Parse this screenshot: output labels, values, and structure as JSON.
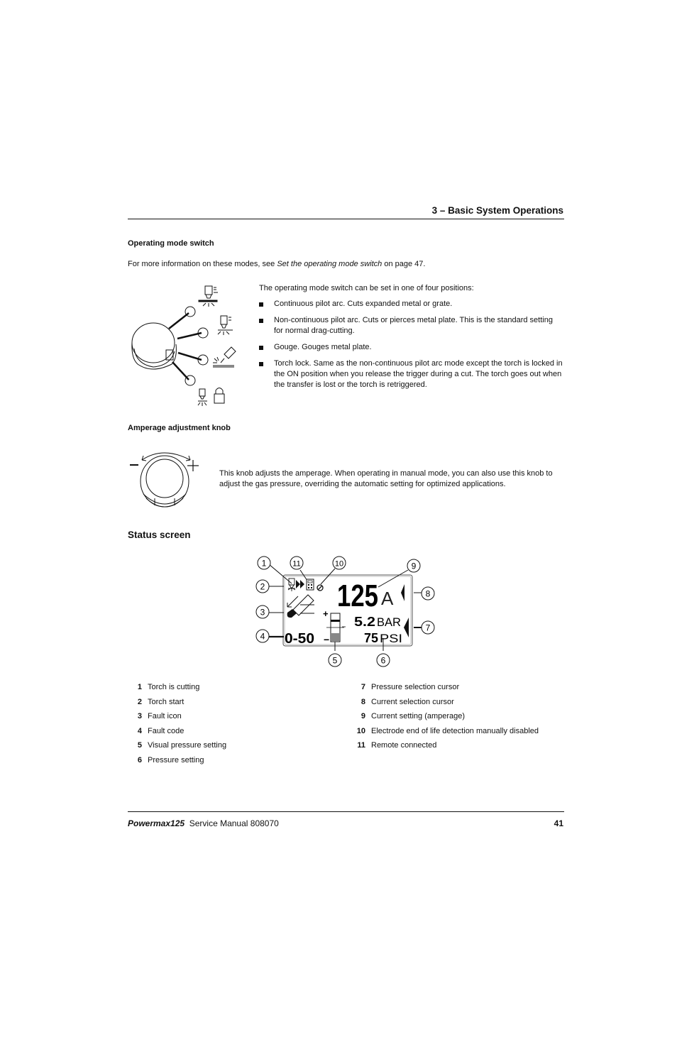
{
  "header": {
    "chapter_title": "3 – Basic System Operations"
  },
  "operating_mode": {
    "heading": "Operating mode switch",
    "intro_prefix": "For more information on these modes, see ",
    "intro_link": "Set the operating mode switch",
    "intro_suffix": " on page 47.",
    "lead": "The operating mode switch can be set in one of four positions:",
    "positions": [
      "Continuous pilot arc. Cuts expanded metal or grate.",
      "Non-continuous pilot arc. Cuts or pierces metal plate. This is the standard setting for normal drag-cutting.",
      "Gouge. Gouges metal plate.",
      "Torch lock. Same as the non-continuous pilot arc mode except the torch is locked in the ON position when you release the trigger during a cut. The torch goes out when the transfer is lost or the torch is retriggered."
    ]
  },
  "amperage_knob": {
    "heading": "Amperage adjustment knob",
    "minus_label": "−",
    "plus_label": "+",
    "description": "This knob adjusts the amperage. When operating in manual mode, you can also use this knob to adjust the gas pressure, overriding the automatic setting for optimized applications."
  },
  "status_screen": {
    "heading": "Status screen",
    "display": {
      "current_value": "125",
      "current_unit": "A",
      "pressure_bar": "5.2",
      "pressure_bar_unit": "BAR",
      "pressure_psi": "75",
      "pressure_psi_unit": "PSI",
      "fault_code": "0-50",
      "plus_sign": "+",
      "minus_sign": "−"
    },
    "callouts": [
      "1",
      "2",
      "3",
      "4",
      "5",
      "6",
      "7",
      "8",
      "9",
      "10",
      "11"
    ],
    "legend_left": [
      {
        "num": "1",
        "label": "Torch is cutting"
      },
      {
        "num": "2",
        "label": "Torch start"
      },
      {
        "num": "3",
        "label": "Fault icon"
      },
      {
        "num": "4",
        "label": "Fault code"
      },
      {
        "num": "5",
        "label": "Visual pressure setting"
      },
      {
        "num": "6",
        "label": "Pressure setting"
      }
    ],
    "legend_right": [
      {
        "num": "7",
        "label": "Pressure selection cursor"
      },
      {
        "num": "8",
        "label": "Current selection cursor"
      },
      {
        "num": "9",
        "label": "Current setting (amperage)"
      },
      {
        "num": "10",
        "label": "Electrode end of life detection manually disabled"
      },
      {
        "num": "11",
        "label": "Remote connected"
      }
    ]
  },
  "footer": {
    "product": "Powermax125",
    "manual": "Service Manual  808070",
    "page_number": "41"
  }
}
